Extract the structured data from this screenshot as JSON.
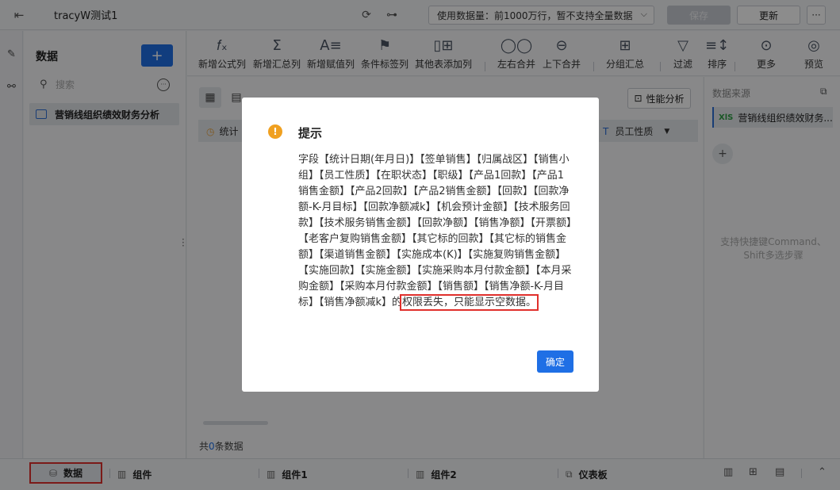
{
  "topbar": {
    "title": "tracyW测试1",
    "usage_select": "使用数据量：前1000万行，暂不支持全量数据",
    "save_label": "保存",
    "update_label": "更新",
    "more_label": "···"
  },
  "data_panel": {
    "title": "数据",
    "add_label": "+",
    "search_placeholder": "搜索",
    "dataset": "营销线组织绩效财务分析"
  },
  "toolbar": {
    "items": [
      {
        "label": "新增公式列",
        "icon": "fx-icon",
        "glyph": "𝑓ₓ"
      },
      {
        "label": "新增汇总列",
        "icon": "sigma-icon",
        "glyph": "Σ"
      },
      {
        "label": "新增赋值列",
        "icon": "assign-icon",
        "glyph": "A≡"
      },
      {
        "label": "条件标签列",
        "icon": "flag-icon",
        "glyph": "⚑"
      },
      {
        "label": "其他表添加列",
        "icon": "add-column-icon",
        "glyph": "▯⊞"
      },
      {
        "label": "左右合并",
        "icon": "join-lr-icon",
        "glyph": "◯◯"
      },
      {
        "label": "上下合并",
        "icon": "join-tb-icon",
        "glyph": "⊖"
      },
      {
        "label": "分组汇总",
        "icon": "group-icon",
        "glyph": "⊞"
      },
      {
        "label": "过滤",
        "icon": "filter-icon",
        "glyph": "▽"
      },
      {
        "label": "排序",
        "icon": "sort-icon",
        "glyph": "≡↕"
      },
      {
        "label": "更多",
        "icon": "more-icon",
        "glyph": "⊙"
      },
      {
        "label": "预览",
        "icon": "preview-icon",
        "glyph": "◎"
      }
    ]
  },
  "main": {
    "perf_label": "性能分析",
    "header_first": "统计",
    "header_last": "员工性质",
    "row_count_prefix": "共",
    "row_count": "0",
    "row_count_suffix": "条数据"
  },
  "right_panel": {
    "title": "数据来源",
    "source_tag": "XlS",
    "source": "营销线组织绩效财务...",
    "add_label": "+",
    "hint": "支持快捷键Command、Shift多选步骤"
  },
  "bottom_tabs": [
    {
      "label": "数据"
    },
    {
      "label": "组件"
    },
    {
      "label": "组件1"
    },
    {
      "label": "组件2"
    },
    {
      "label": "仪表板"
    }
  ],
  "modal": {
    "title": "提示",
    "body": "字段【统计日期(年月日)】【签单销售】【归属战区】【销售小组】【员工性质】【在职状态】【职级】【产品1回款】【产品1销售金额】【产品2回款】【产品2销售金额】【回款】【回款净额-K-月目标】【回款净额减k】【机会预计金额】【技术服务回款】【技术服务销售金额】【回款净额】【销售净额】【开票额】【老客户复购销售金额】【其它标的回款】【其它标的销售金额】【渠道销售金额】【实施成本(K)】【实施复购销售金额】【实施回款】【实施金额】【实施采购本月付款金额】【本月采购金额】【采购本月付款金额】【销售额】【销售净额-K-月目标】【销售净额减k】的",
    "body_highlight": "权限丢失，只能显示空数据。",
    "ok_label": "确定"
  }
}
